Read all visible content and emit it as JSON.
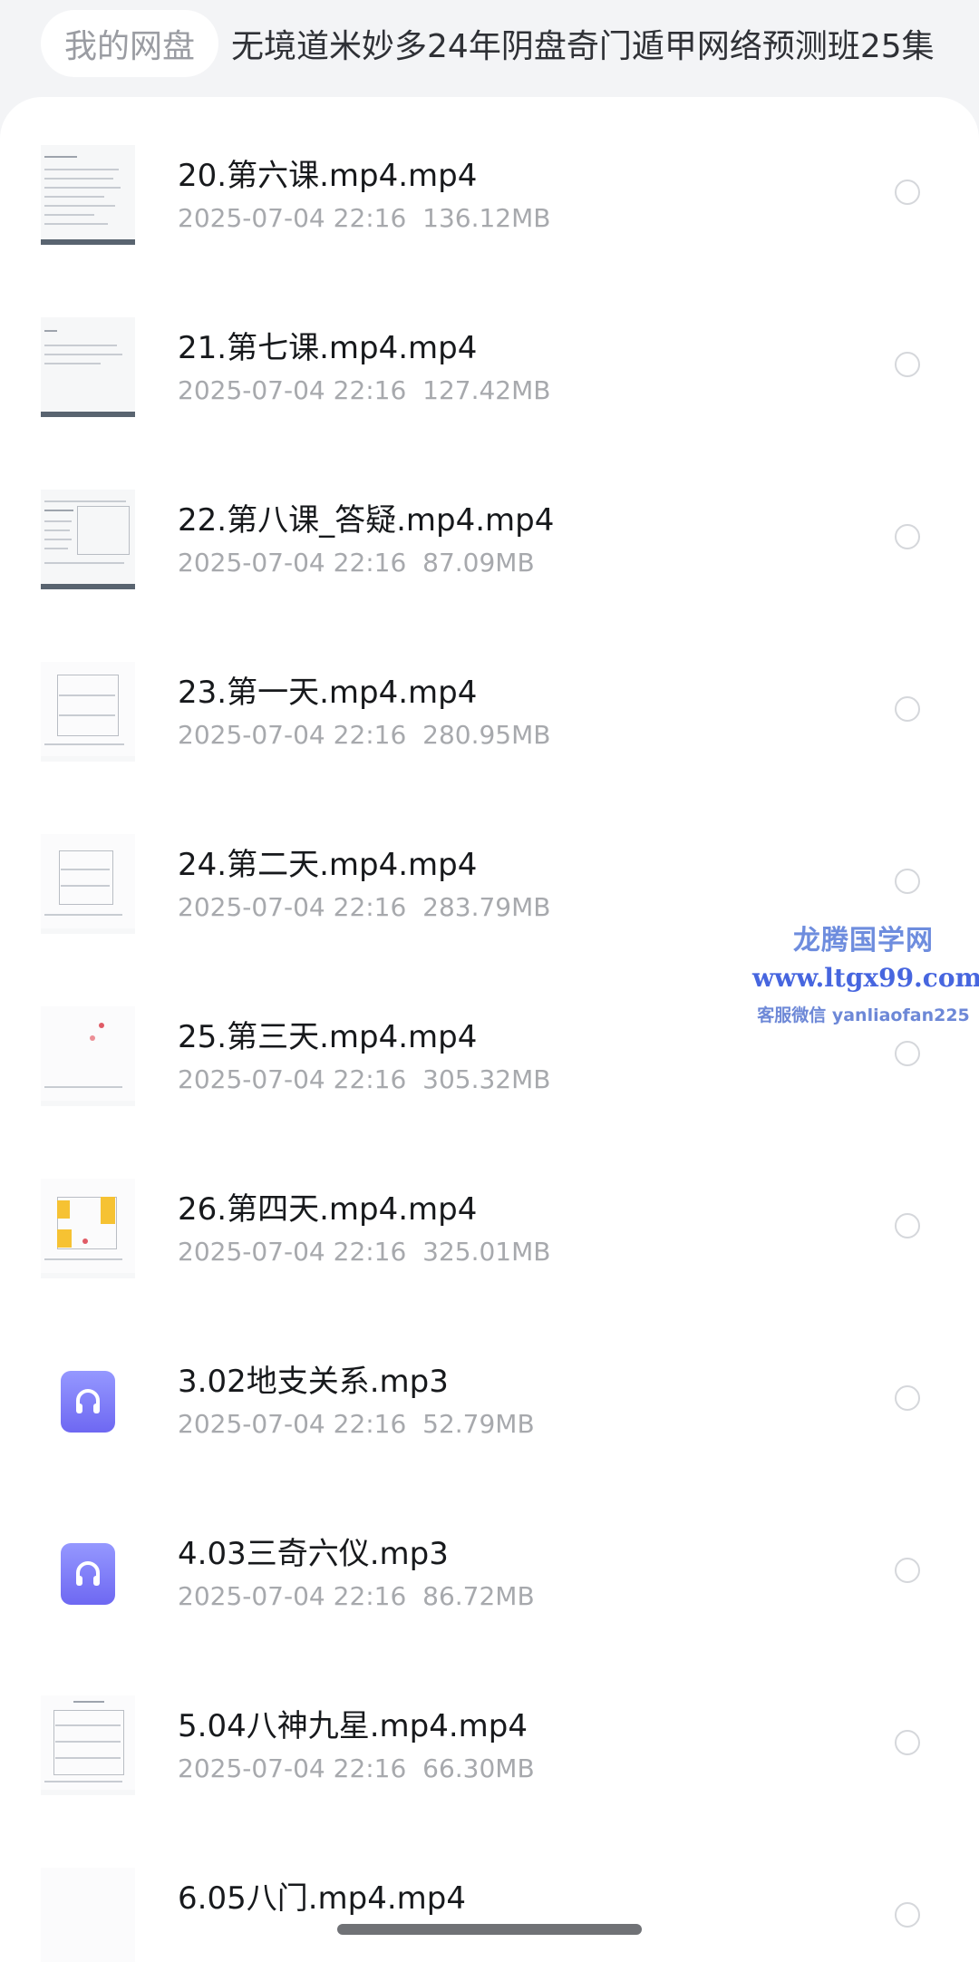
{
  "breadcrumb": {
    "root": "我的网盘",
    "current": "无境道米妙多24年阴盘奇门遁甲网络预测班25集"
  },
  "files": [
    {
      "name": "20.第六课.mp4.mp4",
      "date": "2025-07-04 22:16",
      "size": "136.12MB",
      "thumb": "video-thumbnail",
      "selected": false
    },
    {
      "name": "21.第七课.mp4.mp4",
      "date": "2025-07-04 22:16",
      "size": "127.42MB",
      "thumb": "video-thumbnail",
      "selected": false
    },
    {
      "name": "22.第八课_答疑.mp4.mp4",
      "date": "2025-07-04 22:16",
      "size": "87.09MB",
      "thumb": "video-thumbnail",
      "selected": false
    },
    {
      "name": "23.第一天.mp4.mp4",
      "date": "2025-07-04 22:16",
      "size": "280.95MB",
      "thumb": "video-thumbnail",
      "selected": false
    },
    {
      "name": "24.第二天.mp4.mp4",
      "date": "2025-07-04 22:16",
      "size": "283.79MB",
      "thumb": "video-thumbnail",
      "selected": false
    },
    {
      "name": "25.第三天.mp4.mp4",
      "date": "2025-07-04 22:16",
      "size": "305.32MB",
      "thumb": "video-thumbnail",
      "selected": false
    },
    {
      "name": "26.第四天.mp4.mp4",
      "date": "2025-07-04 22:16",
      "size": "325.01MB",
      "thumb": "video-thumbnail",
      "selected": false
    },
    {
      "name": "3.02地支关系.mp3",
      "date": "2025-07-04 22:16",
      "size": "52.79MB",
      "thumb": "audio-file-icon",
      "selected": false
    },
    {
      "name": "4.03三奇六仪.mp3",
      "date": "2025-07-04 22:16",
      "size": "86.72MB",
      "thumb": "audio-file-icon",
      "selected": false
    },
    {
      "name": "5.04八神九星.mp4.mp4",
      "date": "2025-07-04 22:16",
      "size": "66.30MB",
      "thumb": "video-thumbnail",
      "selected": false
    },
    {
      "name": "6.05八门.mp4.mp4",
      "date": "",
      "size": "",
      "thumb": "video-thumbnail",
      "selected": false
    }
  ],
  "watermark": {
    "title": "龙腾国学网",
    "url": "www.ltgx99.com",
    "contact": "客服微信 yanliaofan225"
  },
  "colors": {
    "audio_icon": "#7f7cf8",
    "file_name": "#17191c",
    "meta_text": "#a7a9ad",
    "watermark": "#5a78dc"
  }
}
